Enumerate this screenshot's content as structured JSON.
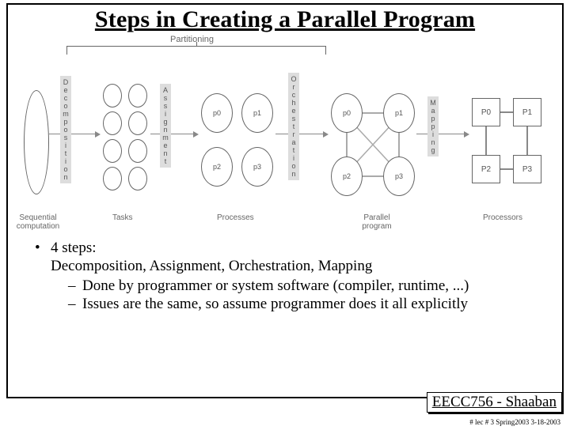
{
  "title": "Steps in Creating a Parallel Program",
  "diagram": {
    "partitioning": "Partitioning",
    "arrows": {
      "decomposition": "Decomposition",
      "assignment": "Assignment",
      "orchestration": "Orchestration",
      "mapping": "Mapping"
    },
    "procs": {
      "p0": "p0",
      "p1": "p1",
      "p2": "p2",
      "p3": "p3"
    },
    "cpus": {
      "P0": "P0",
      "P1": "P1",
      "P2": "P2",
      "P3": "P3"
    },
    "labels": {
      "sequential": "Sequential\ncomputation",
      "tasks": "Tasks",
      "processes": "Processes",
      "parallel": "Parallel\nprogram",
      "processors": "Processors"
    }
  },
  "body": {
    "bullet1": "4 steps:",
    "stepsLine": "Decomposition, Assignment, Orchestration, Mapping",
    "sub1": "Done by programmer or system software (compiler, runtime, ...)",
    "sub2": "Issues are the same, so assume programmer does it all explicitly"
  },
  "footer": {
    "box": "EECC756 - Shaaban",
    "line": "#  lec # 3    Spring2003   3-18-2003"
  }
}
